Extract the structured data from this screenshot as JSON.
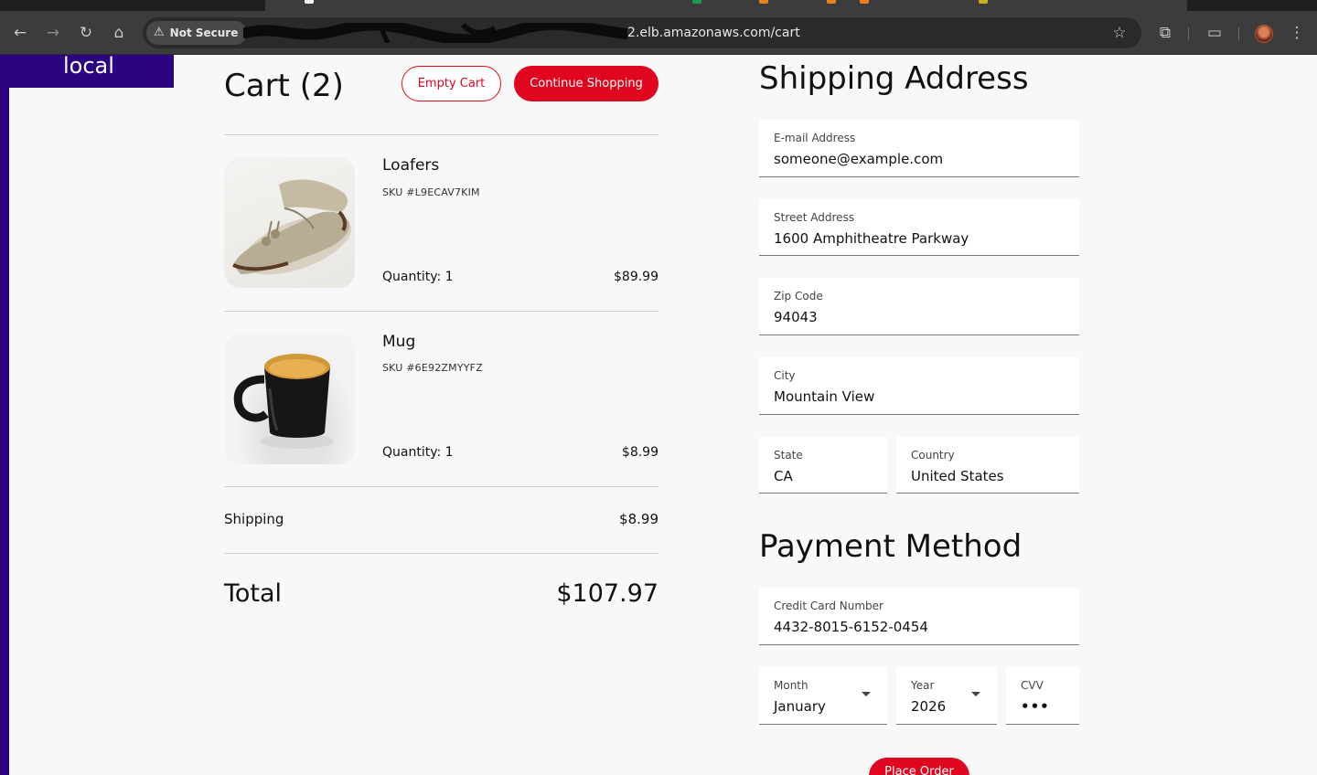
{
  "browser": {
    "security_label": "Not Secure",
    "url_visible": "2.elb.amazonaws.com/cart",
    "icons": [
      "back-icon",
      "forward-icon",
      "reload-icon",
      "home-icon",
      "warning-icon",
      "star-icon",
      "extensions-icon",
      "tab-search-icon",
      "avatar",
      "menu-icon"
    ]
  },
  "env_badge": "local",
  "cart": {
    "title": "Cart (2)",
    "empty_label": "Empty Cart",
    "continue_label": "Continue Shopping",
    "items": [
      {
        "name": "Loafers",
        "sku": "SKU #L9ECAV7KIM",
        "quantity": "Quantity: 1",
        "price": "$89.99"
      },
      {
        "name": "Mug",
        "sku": "SKU #6E92ZMYYFZ",
        "quantity": "Quantity: 1",
        "price": "$8.99"
      }
    ],
    "shipping_label": "Shipping",
    "shipping_value": "$8.99",
    "total_label": "Total",
    "total_value": "$107.97"
  },
  "shipping": {
    "title": "Shipping Address",
    "email_label": "E-mail Address",
    "email_value": "someone@example.com",
    "street_label": "Street Address",
    "street_value": "1600 Amphitheatre Parkway",
    "zip_label": "Zip Code",
    "zip_value": "94043",
    "city_label": "City",
    "city_value": "Mountain View",
    "state_label": "State",
    "state_value": "CA",
    "country_label": "Country",
    "country_value": "United States"
  },
  "payment": {
    "title": "Payment Method",
    "card_label": "Credit Card Number",
    "card_value": "4432-8015-6152-0454",
    "month_label": "Month",
    "month_value": "January",
    "year_label": "Year",
    "year_value": "2026",
    "cvv_label": "CVV",
    "cvv_value": "•••",
    "place_order_label": "Place Order"
  },
  "colors": {
    "accent": "#e0061f",
    "env_badge_bg": "#2c0480",
    "page_bg": "#f8f8f8"
  }
}
